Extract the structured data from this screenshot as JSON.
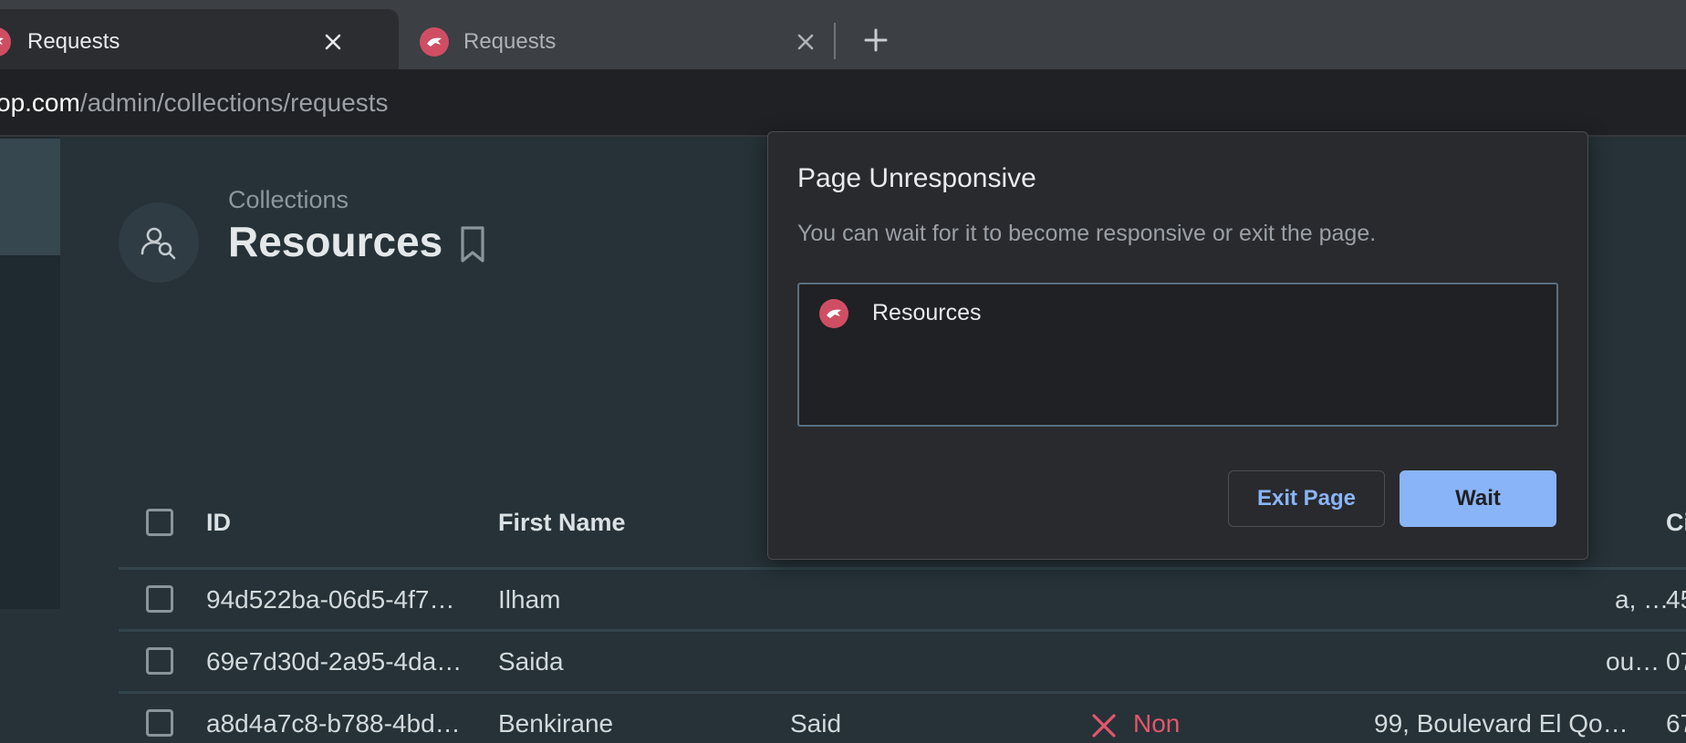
{
  "browser": {
    "tabs": [
      {
        "title": "Requests",
        "active": true
      },
      {
        "title": "Requests",
        "active": false
      }
    ],
    "url_host": "op.com",
    "url_path": "/admin/collections/requests"
  },
  "header": {
    "breadcrumb": "Collections",
    "title": "Resources"
  },
  "table": {
    "columns": [
      "ID",
      "First Name",
      "Ci"
    ],
    "rows": [
      {
        "id": "94d522ba-06d5-4f7…",
        "first_name": "Ilham",
        "address": "a, …",
        "city": "45"
      },
      {
        "id": "69e7d30d-2a95-4da…",
        "first_name": "Saida",
        "address": "ou…",
        "city": "07"
      },
      {
        "id": "a8d4a7c8-b788-4bd…",
        "first_name": "Benkirane",
        "last_name": "Said",
        "status": "Non",
        "address": "99, Boulevard El Qo…",
        "city": "67"
      }
    ]
  },
  "dialog": {
    "title": "Page Unresponsive",
    "message": "You can wait for it to become responsive or exit the page.",
    "list_item": "Resources",
    "exit_label": "Exit Page",
    "wait_label": "Wait"
  },
  "colors": {
    "favicon": "#cf4e63",
    "accent_blue": "#8ab4f8",
    "status_red": "#e3566b"
  }
}
